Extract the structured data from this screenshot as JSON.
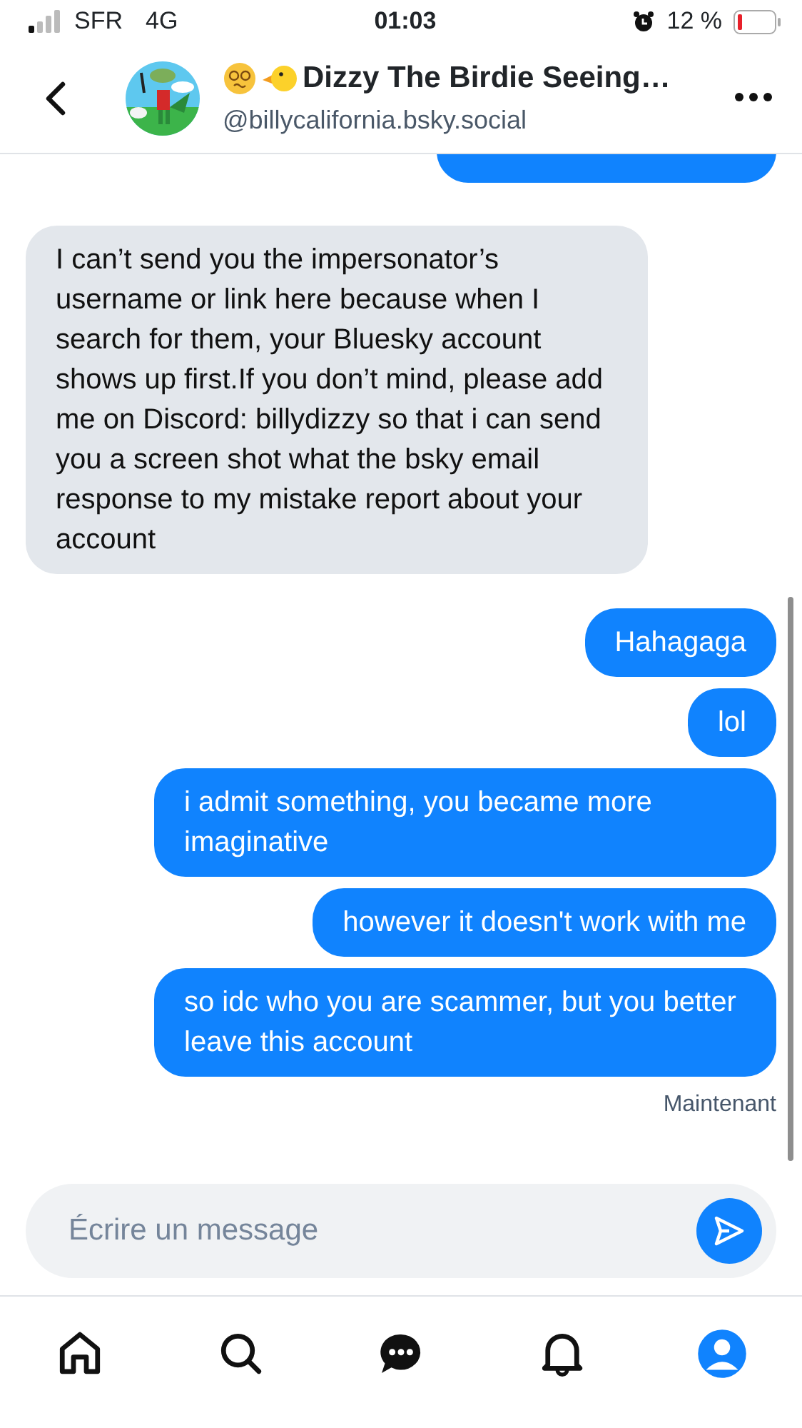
{
  "status_bar": {
    "carrier": "SFR",
    "network": "4G",
    "time": "01:03",
    "battery": "12 %"
  },
  "header": {
    "name": "Dizzy The Birdie Seeing…",
    "handle": "@billycalifornia.bsky.social"
  },
  "messages": [
    {
      "kind": "received",
      "text": "I can’t send you the impersonator’s username or link here because when I search for them, your Bluesky account shows up first.If you don’t mind, please add me on Discord: billydizzy so that i can send you a screen shot what the bsky email response to my mistake report about your account"
    },
    {
      "kind": "sent",
      "text": "Hahagaga"
    },
    {
      "kind": "sent",
      "text": "lol"
    },
    {
      "kind": "sent",
      "text": "i admit something, you became more imaginative"
    },
    {
      "kind": "sent",
      "text": "however it doesn't work with me"
    },
    {
      "kind": "sent",
      "text": "so idc who you are scammer, but you better leave this account"
    }
  ],
  "timestamp": "Maintenant",
  "composer": {
    "placeholder": "Écrire un message"
  },
  "tabs": [
    {
      "kind": "home"
    },
    {
      "kind": "search"
    },
    {
      "kind": "chat"
    },
    {
      "kind": "bell"
    },
    {
      "kind": "profile"
    }
  ]
}
